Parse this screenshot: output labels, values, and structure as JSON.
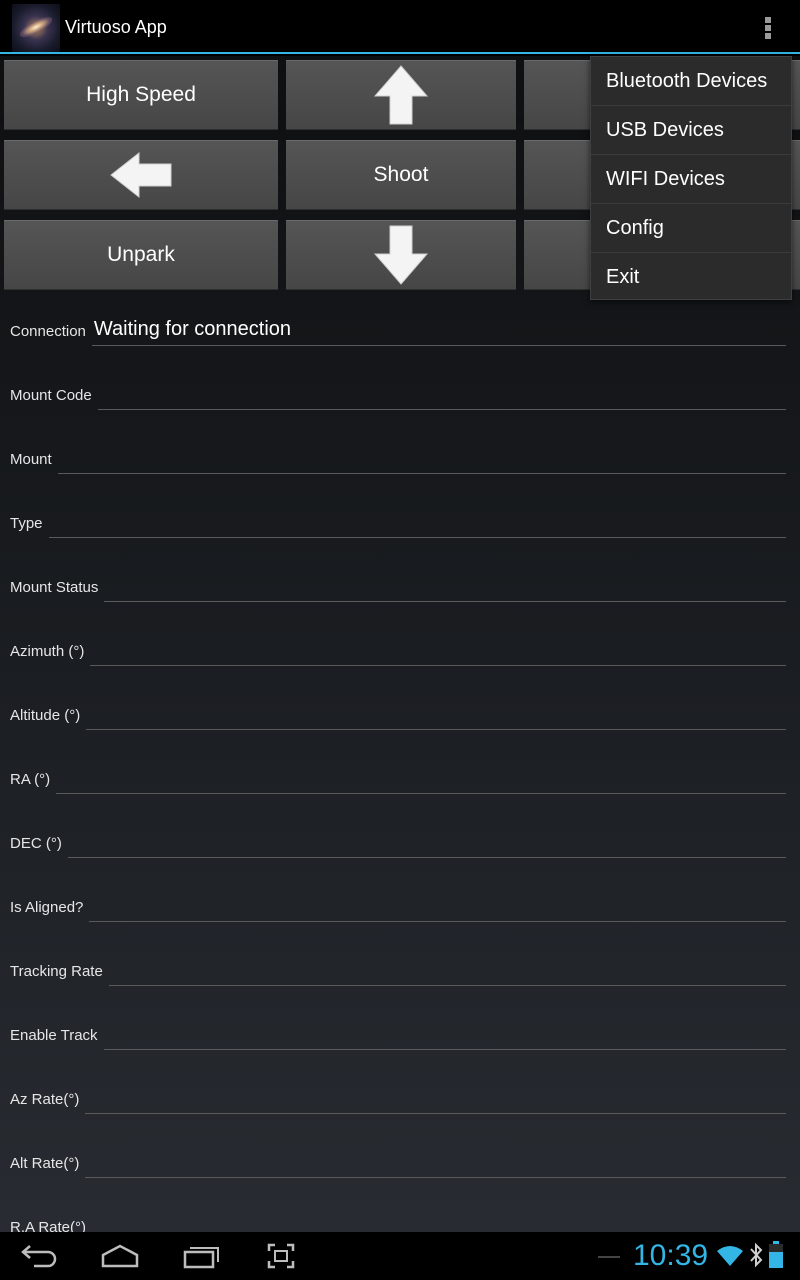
{
  "app": {
    "title": "Virtuoso App"
  },
  "controls": {
    "high_speed": "High Speed",
    "shoot": "Shoot",
    "unpark": "Unpark"
  },
  "fields": [
    {
      "label": "Connection",
      "value": "Waiting for connection"
    },
    {
      "label": "Mount Code",
      "value": ""
    },
    {
      "label": "Mount",
      "value": ""
    },
    {
      "label": "Type",
      "value": ""
    },
    {
      "label": "Mount Status",
      "value": ""
    },
    {
      "label": "Azimuth (°)",
      "value": ""
    },
    {
      "label": "Altitude (°)",
      "value": ""
    },
    {
      "label": "RA (°)",
      "value": ""
    },
    {
      "label": "DEC (°)",
      "value": ""
    },
    {
      "label": "Is Aligned?",
      "value": ""
    },
    {
      "label": "Tracking Rate",
      "value": ""
    },
    {
      "label": "Enable Track",
      "value": ""
    },
    {
      "label": "Az Rate(°)",
      "value": ""
    },
    {
      "label": "Alt Rate(°)",
      "value": ""
    },
    {
      "label": "R.A Rate(°)",
      "value": ""
    }
  ],
  "menu": {
    "items": [
      "Bluetooth Devices",
      "USB Devices",
      "WIFI Devices",
      "Config",
      "Exit"
    ]
  },
  "status": {
    "time": "10:39"
  },
  "colors": {
    "accent": "#33b5e5",
    "button": "#4d4d4d",
    "menu_bg": "#2b2b2b"
  },
  "icons": [
    "app-icon",
    "overflow-menu-icon",
    "arrow-up-icon",
    "arrow-left-icon",
    "arrow-down-icon",
    "back-icon",
    "home-icon",
    "recent-apps-icon",
    "screenshot-icon",
    "wifi-icon",
    "bluetooth-icon",
    "battery-icon"
  ]
}
